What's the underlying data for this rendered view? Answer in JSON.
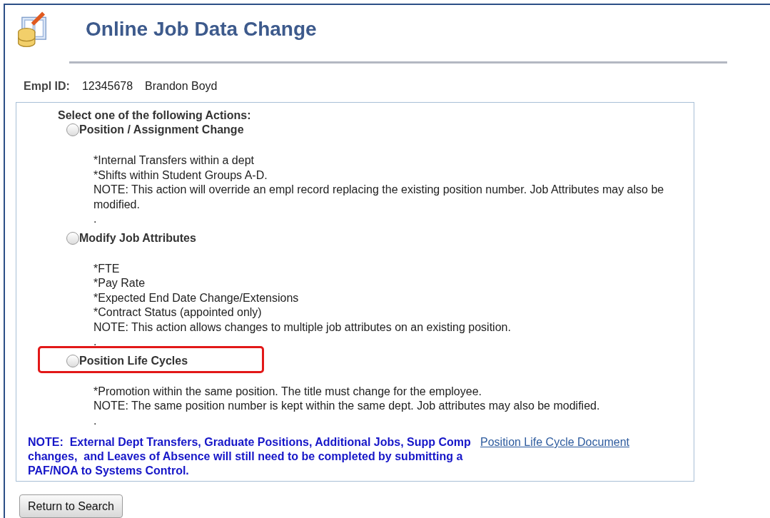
{
  "page": {
    "title": "Online Job Data Change"
  },
  "employee": {
    "label": "Empl ID:",
    "id": "12345678",
    "name": "Brandon Boyd"
  },
  "actions_heading": "Select one of the following Actions:",
  "actions": [
    {
      "label": "Position / Assignment Change",
      "selected": false,
      "highlighted": false,
      "lines": [
        "*Internal Transfers within a dept",
        "*Shifts within Student Groups A-D.",
        "NOTE: This action will override an empl record replacing the existing position number. Job Attributes may also be modified.",
        "."
      ]
    },
    {
      "label": "Modify Job Attributes",
      "selected": false,
      "highlighted": false,
      "lines": [
        "*FTE",
        "*Pay Rate",
        "*Expected End Date Change/Extensions",
        "*Contract Status (appointed only)",
        "NOTE: This action allows changes to multiple job attributes on an existing position.",
        "."
      ]
    },
    {
      "label": "Position Life Cycles",
      "selected": false,
      "highlighted": true,
      "lines": [
        "*Promotion within the same position. The title must change for the employee.",
        "NOTE: The same position number is kept within the same dept. Job attributes may also be modified.",
        "."
      ]
    }
  ],
  "note": "NOTE:  External Dept Transfers, Graduate Positions, Additional Jobs, Supp Comp changes,  and Leaves of Absence will still need to be completed by submitting a PAF/NOA to Systems Control.",
  "link": "Position Life Cycle Document",
  "buttons": [
    "Return to Search"
  ]
}
